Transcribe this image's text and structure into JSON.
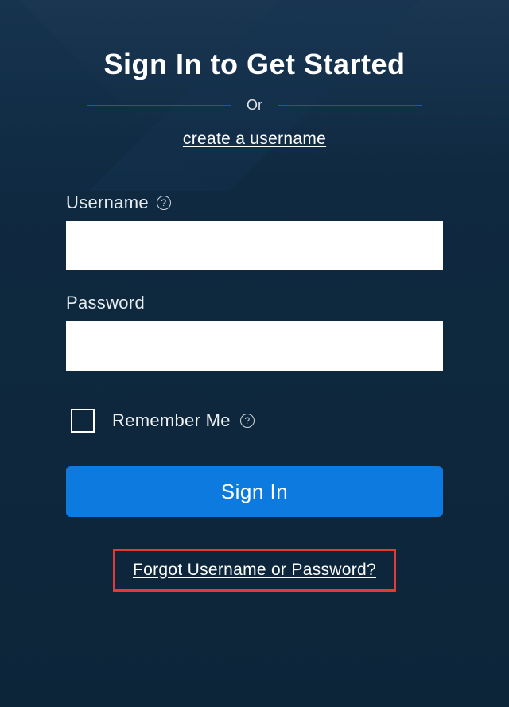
{
  "header": {
    "title": "Sign In to Get Started",
    "divider_text": "Or",
    "create_link": "create a username"
  },
  "form": {
    "username_label": "Username",
    "username_value": "",
    "password_label": "Password",
    "password_value": "",
    "remember_label": "Remember Me",
    "signin_label": "Sign In",
    "forgot_link": "Forgot Username or Password?"
  },
  "icons": {
    "help": "?"
  }
}
